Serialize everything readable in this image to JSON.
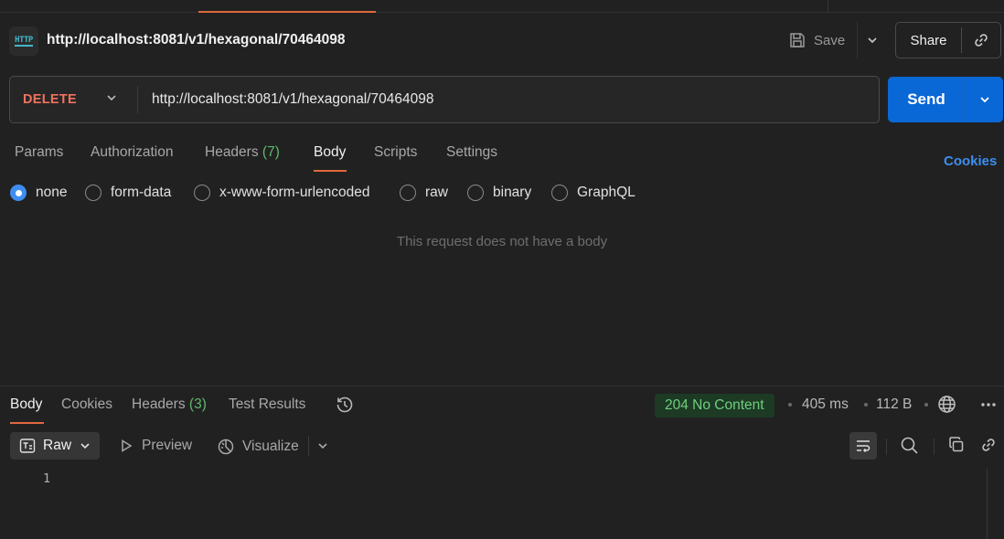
{
  "request": {
    "icon_text": "HTTP",
    "title": "http://localhost:8081/v1/hexagonal/70464098",
    "save_label": "Save",
    "share_label": "Share",
    "method": "DELETE",
    "url": "http://localhost:8081/v1/hexagonal/70464098",
    "send_label": "Send",
    "cookies_label": "Cookies",
    "tabs": [
      {
        "label": "Params"
      },
      {
        "label": "Authorization"
      },
      {
        "label": "Headers",
        "count": "(7)"
      },
      {
        "label": "Body",
        "active": true
      },
      {
        "label": "Scripts"
      },
      {
        "label": "Settings"
      }
    ],
    "body_options": [
      {
        "label": "none",
        "selected": true
      },
      {
        "label": "form-data"
      },
      {
        "label": "x-www-form-urlencoded"
      },
      {
        "label": "raw"
      },
      {
        "label": "binary"
      },
      {
        "label": "GraphQL"
      }
    ],
    "empty_body_message": "This request does not have a body"
  },
  "response": {
    "tabs": [
      {
        "label": "Body",
        "active": true
      },
      {
        "label": "Cookies"
      },
      {
        "label": "Headers",
        "count": "(3)"
      },
      {
        "label": "Test Results"
      }
    ],
    "status": "204 No Content",
    "time": "405 ms",
    "size": "112 B",
    "view_mode": "Raw",
    "preview_label": "Preview",
    "visualize_label": "Visualize",
    "line_numbers": [
      "1"
    ]
  },
  "colors": {
    "background": "#212121",
    "accent_orange": "#e0693f",
    "send_blue": "#0a68d6",
    "method_delete": "#f0735e",
    "status_green": "#6fcf7e",
    "link_blue": "#3d8ef0"
  }
}
